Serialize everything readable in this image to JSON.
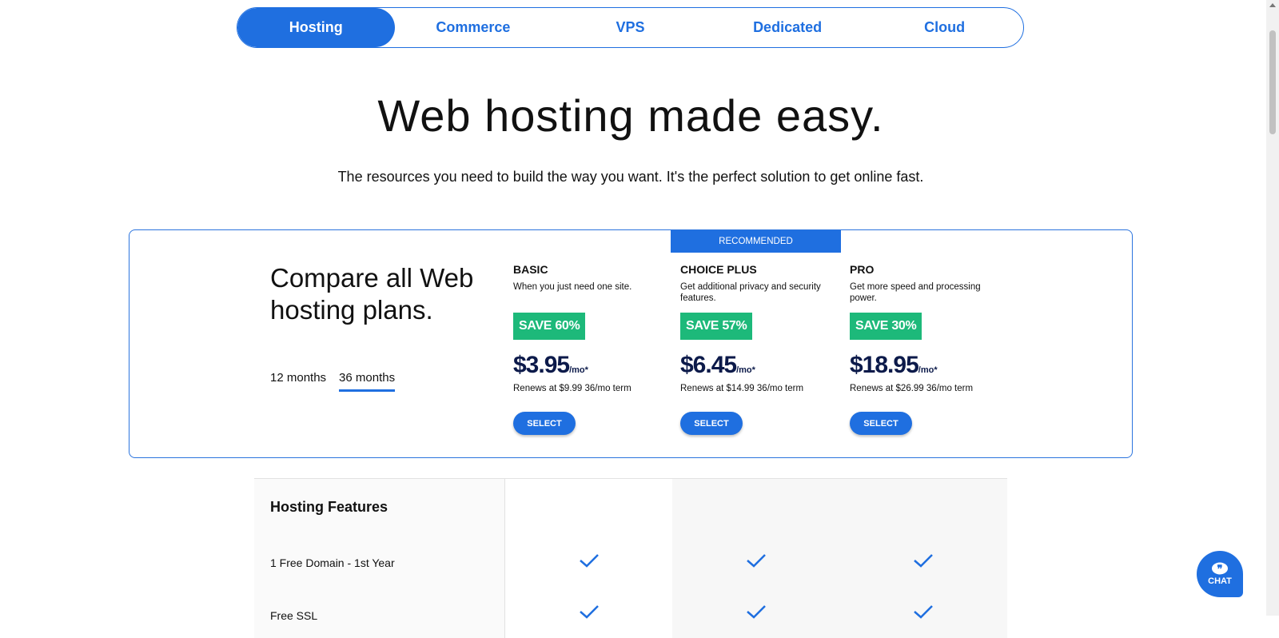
{
  "tabs": [
    {
      "label": "Hosting",
      "active": true
    },
    {
      "label": "Commerce"
    },
    {
      "label": "VPS"
    },
    {
      "label": "Dedicated"
    },
    {
      "label": "Cloud"
    }
  ],
  "hero": {
    "title": "Web hosting made easy.",
    "subtitle": "The resources you need to build the way you want. It's the perfect solution to get online fast."
  },
  "compare": {
    "title": "Compare all Web hosting plans.",
    "terms": [
      {
        "label": "12 months"
      },
      {
        "label": "36 months",
        "active": true
      }
    ],
    "recommended_label": "RECOMMENDED",
    "plans": [
      {
        "name": "BASIC",
        "desc": "When you just need one site.",
        "save": "SAVE 60%",
        "price": "$3.95",
        "per": "/mo*",
        "renew": "Renews at $9.99 36/mo term",
        "select": "SELECT"
      },
      {
        "name": "CHOICE PLUS",
        "desc": "Get additional privacy and security features.",
        "save": "SAVE 57%",
        "price": "$6.45",
        "per": "/mo*",
        "renew": "Renews at $14.99 36/mo term",
        "select": "SELECT"
      },
      {
        "name": "PRO",
        "desc": "Get more speed and processing power.",
        "save": "SAVE 30%",
        "price": "$18.95",
        "per": "/mo*",
        "renew": "Renews at $26.99 36/mo term",
        "select": "SELECT"
      }
    ]
  },
  "features": {
    "header": "Hosting Features",
    "rows": [
      {
        "label": "1 Free Domain - 1st Year"
      },
      {
        "label": "Free SSL"
      }
    ]
  },
  "chat": {
    "label": "CHAT"
  },
  "colors": {
    "accent": "#1f6fe0",
    "save_green": "#1db97a",
    "price_navy": "#0c1a4a"
  }
}
